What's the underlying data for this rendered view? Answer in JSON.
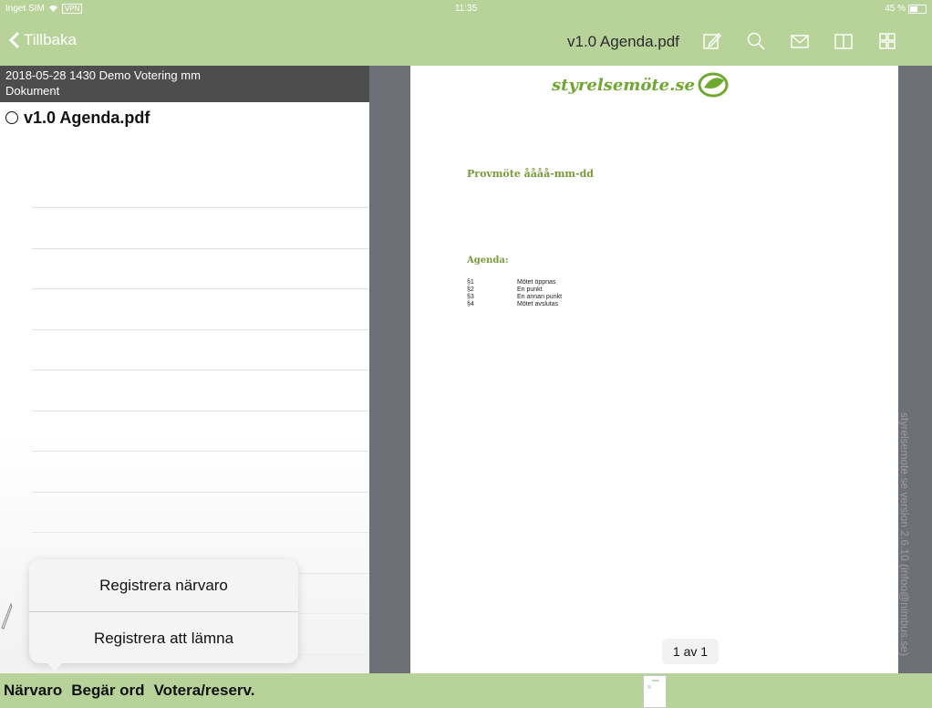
{
  "status_bar": {
    "carrier": "Inget SIM",
    "vpn": "VPN",
    "time": "11:35",
    "battery": "45 %"
  },
  "nav": {
    "back_label": "Tillbaka",
    "doc_title": "v1.0 Agenda.pdf"
  },
  "nav_icons": [
    "edit-icon",
    "search-icon",
    "mail-icon",
    "book-icon",
    "grid-icon"
  ],
  "master": {
    "header_line1": "2018-05-28 1430  Demo Votering mm",
    "header_line2": "Dokument",
    "documents": [
      {
        "name": "v1.0 Agenda.pdf"
      }
    ]
  },
  "popover": {
    "items": [
      {
        "label": "Registrera närvaro"
      },
      {
        "label": "Registrera att lämna"
      }
    ]
  },
  "document": {
    "logo_text": "styrelsemöte.se",
    "meeting_title": "Provmöte åååå-mm-dd",
    "agenda_heading": "Agenda:",
    "agenda_items": [
      {
        "num": "§1",
        "text": "Mötet öppnas"
      },
      {
        "num": "§2",
        "text": "En punkt"
      },
      {
        "num": "§3",
        "text": "En annan punkt"
      },
      {
        "num": "§4",
        "text": "Mötet avslutas"
      }
    ],
    "page_indicator": "1 av 1"
  },
  "side_text": "styrelsemote.se version 2.6.10 (infoo@nimbus.se)",
  "toolbar": {
    "presence": "Närvaro",
    "request_word": "Begär ord",
    "vote": "Votera/reserv."
  },
  "colors": {
    "accent": "#b8d39a",
    "header_dark": "#4d4d4d",
    "logo_green": "#6ea82f"
  }
}
